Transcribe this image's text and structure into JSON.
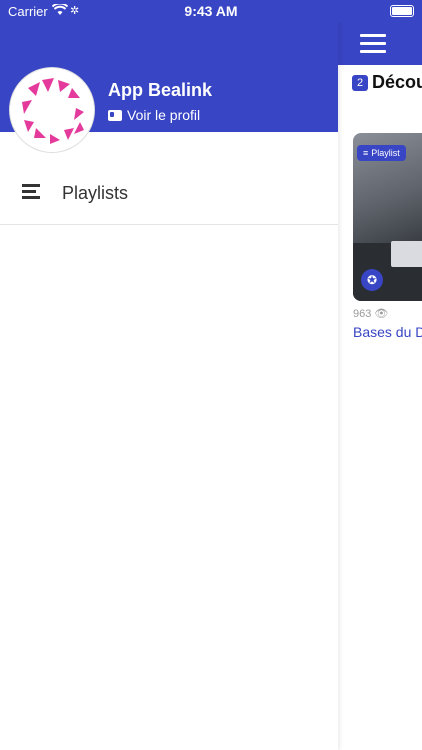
{
  "status": {
    "carrier": "Carrier",
    "time": "9:43 AM"
  },
  "drawer": {
    "app_name": "App Bealink",
    "profile_link": "Voir le profil",
    "menu_items": [
      {
        "label": "Playlists"
      }
    ]
  },
  "background": {
    "section_count": "2",
    "section_title": "Décou",
    "card": {
      "tag": "Playlist",
      "views": "963",
      "title": "Bases du D"
    }
  },
  "colors": {
    "accent": "#3845c4",
    "avatar_pattern": "#e33a9c"
  }
}
